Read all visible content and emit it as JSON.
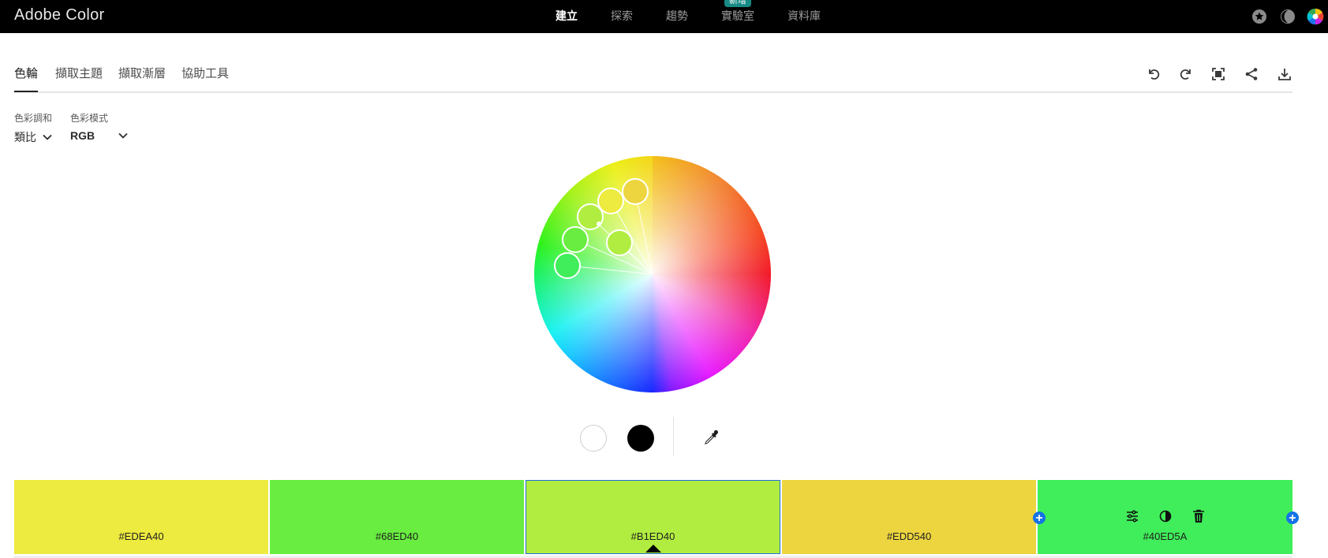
{
  "app": {
    "title": "Adobe Color",
    "nav": [
      {
        "label": "建立",
        "active": true
      },
      {
        "label": "探索",
        "active": false
      },
      {
        "label": "趨勢",
        "active": false
      },
      {
        "label": "實驗室",
        "active": false,
        "badge": "新增"
      },
      {
        "label": "資料庫",
        "active": false
      }
    ],
    "top_icons": [
      "star-icon",
      "contrast-icon",
      "color-wheel-avatar-icon"
    ]
  },
  "tabs": [
    {
      "label": "色輪",
      "active": true
    },
    {
      "label": "擷取主題",
      "active": false
    },
    {
      "label": "擷取漸層",
      "active": false
    },
    {
      "label": "協助工具",
      "active": false
    }
  ],
  "toolbar": [
    "undo-icon",
    "redo-icon",
    "fullscreen-icon",
    "share-icon",
    "download-icon"
  ],
  "harmony": {
    "label": "色彩調和",
    "value": "類比"
  },
  "color_mode": {
    "label": "色彩模式",
    "value": "RGB"
  },
  "wheel": {
    "selected_index": 2
  },
  "swatch_controls": [
    "white-swatch",
    "black-swatch",
    "eyedropper-icon"
  ],
  "palette": [
    {
      "hex": "#EDEA40",
      "color": "#EDEA40"
    },
    {
      "hex": "#68ED40",
      "color": "#68ED40"
    },
    {
      "hex": "#B1ED40",
      "color": "#B1ED40",
      "selected": true
    },
    {
      "hex": "#EDD540",
      "color": "#EDD540"
    },
    {
      "hex": "#40ED5A",
      "color": "#40ED5A",
      "hovered": true
    }
  ]
}
